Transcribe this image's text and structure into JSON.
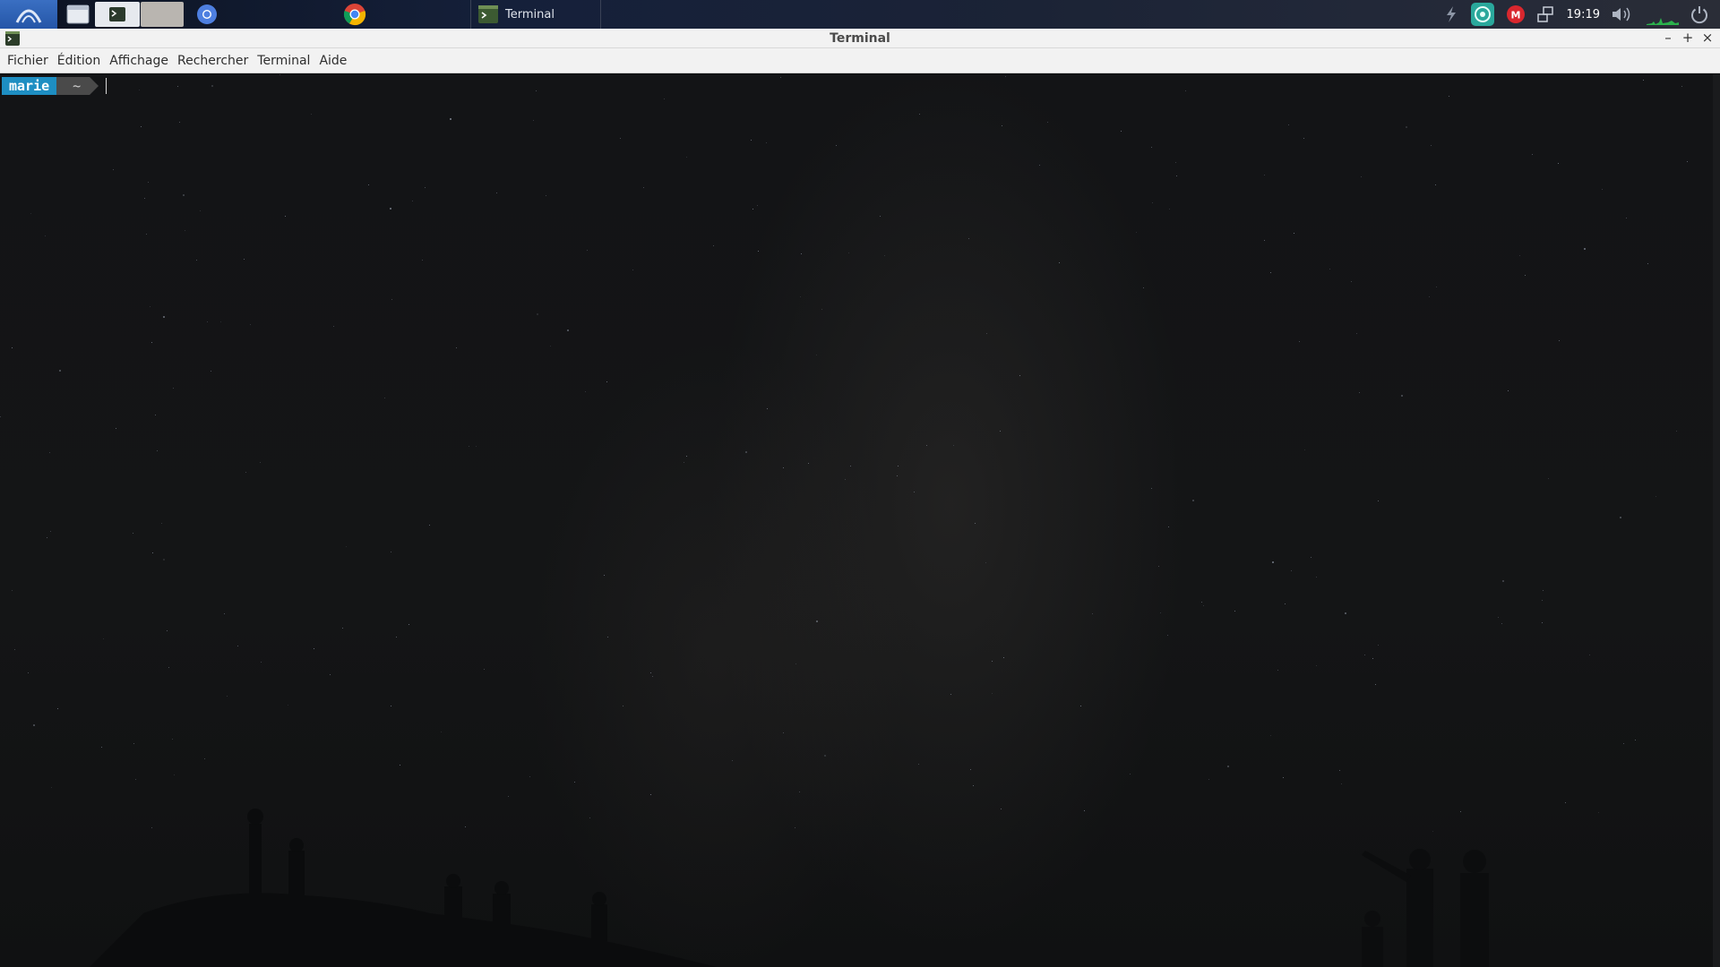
{
  "panel": {
    "tasks": [
      {
        "label": "",
        "icon": "chromium-icon"
      },
      {
        "label": "",
        "icon": "chrome-icon"
      },
      {
        "label": "Terminal",
        "icon": "terminal-icon",
        "active": true
      }
    ],
    "clock": "19:19",
    "tray_icons": [
      "lightning-icon",
      "vpn-icon",
      "mega-icon",
      "network-icon",
      "volume-icon",
      "cpu-graph-icon",
      "power-icon"
    ]
  },
  "window": {
    "title": "Terminal",
    "menu": [
      "Fichier",
      "Édition",
      "Affichage",
      "Rechercher",
      "Terminal",
      "Aide"
    ]
  },
  "terminal": {
    "user": "marie",
    "cwd": "~"
  },
  "colors": {
    "prompt_user_bg": "#1e8ec2",
    "prompt_dir_bg": "#4a4a4a",
    "launcher_bg": "#2f63b5"
  }
}
